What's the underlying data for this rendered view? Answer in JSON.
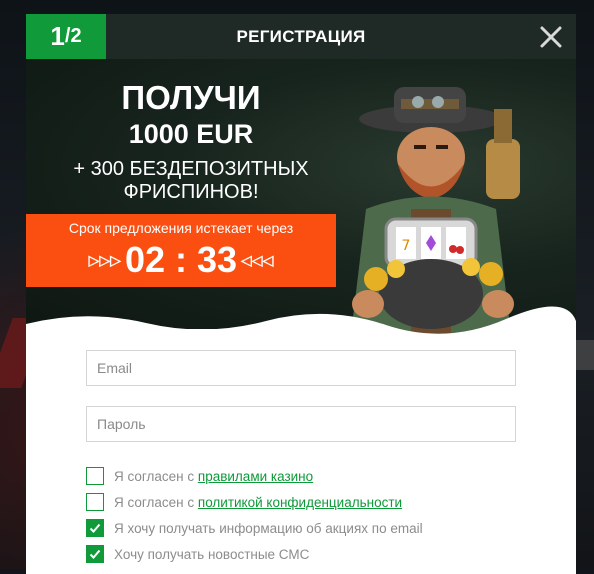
{
  "modal": {
    "step_current": "1",
    "step_total": "/2",
    "title": "РЕГИСТРАЦИЯ"
  },
  "promo": {
    "line1": "ПОЛУЧИ",
    "line2": "1000 EUR",
    "line3": "+ 300 БЕЗДЕПОЗИТНЫХ",
    "line4": "ФРИСПИНОВ!"
  },
  "timer": {
    "label": "Срок предложения истекает через",
    "arrows_left": "▷▷▷",
    "value": "02 : 33",
    "arrows_right": "◁◁◁"
  },
  "form": {
    "email_placeholder": "Email",
    "password_placeholder": "Пароль"
  },
  "checkboxes": [
    {
      "prefix": "Я согласен с ",
      "link": "правилами казино",
      "checked": false
    },
    {
      "prefix": "Я согласен с ",
      "link": "политикой конфиденциальности",
      "checked": false
    },
    {
      "prefix": "Я хочу получать информацию об акциях по email",
      "link": "",
      "checked": true
    },
    {
      "prefix": "Хочу получать новостные СМС",
      "link": "",
      "checked": true
    }
  ],
  "colors": {
    "accent_green": "#119a3a",
    "timer_orange": "#fb4f12",
    "header_dark": "#1f2a26"
  }
}
